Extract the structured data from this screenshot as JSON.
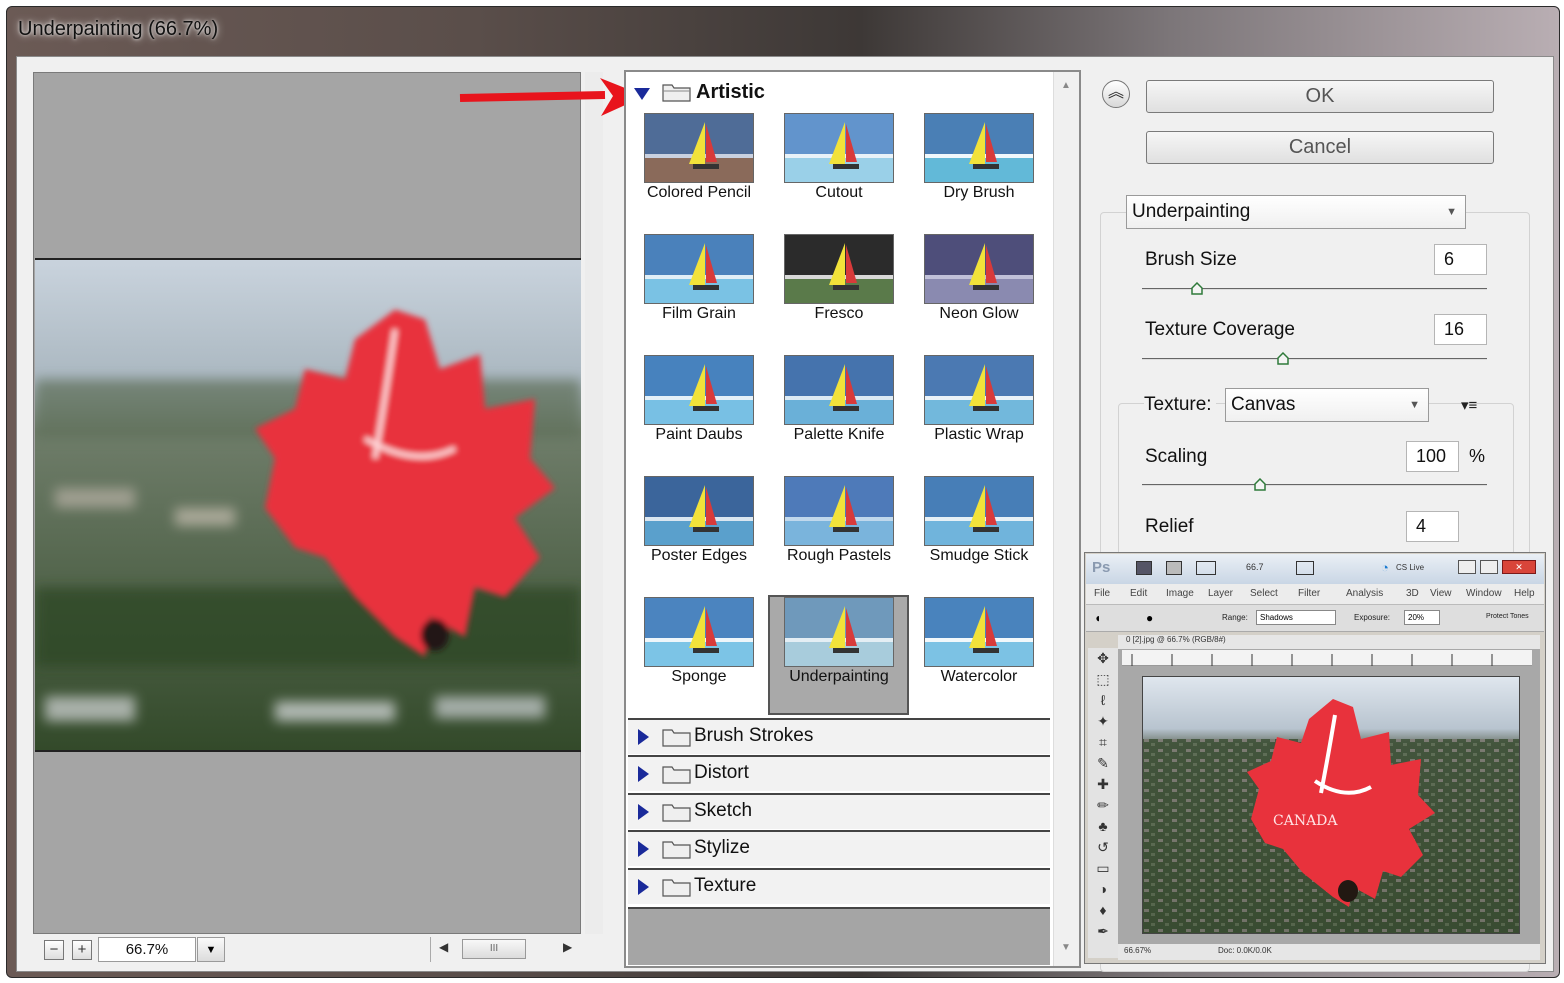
{
  "window": {
    "title": "Underpainting (66.7%)"
  },
  "preview": {
    "zoom": "66.7%",
    "zoom_out_label": "−",
    "zoom_in_label": "+",
    "scroll_grip": "III"
  },
  "gallery": {
    "category_open": "Artistic",
    "filters": [
      {
        "label": "Colored Pencil"
      },
      {
        "label": "Cutout"
      },
      {
        "label": "Dry Brush"
      },
      {
        "label": "Film Grain"
      },
      {
        "label": "Fresco"
      },
      {
        "label": "Neon Glow"
      },
      {
        "label": "Paint Daubs"
      },
      {
        "label": "Palette Knife"
      },
      {
        "label": "Plastic Wrap"
      },
      {
        "label": "Poster Edges"
      },
      {
        "label": "Rough Pastels"
      },
      {
        "label": "Smudge Stick"
      },
      {
        "label": "Sponge"
      },
      {
        "label": "Underpainting"
      },
      {
        "label": "Watercolor"
      }
    ],
    "selected_filter": "Underpainting",
    "categories_closed": [
      "Brush Strokes",
      "Distort",
      "Sketch",
      "Stylize",
      "Texture"
    ]
  },
  "buttons": {
    "ok": "OK",
    "cancel": "Cancel"
  },
  "settings": {
    "filter": "Underpainting",
    "brush_size_label": "Brush Size",
    "brush_size": "6",
    "texture_coverage_label": "Texture Coverage",
    "texture_coverage": "16",
    "texture_label": "Texture:",
    "texture": "Canvas",
    "scaling_label": "Scaling",
    "scaling": "100",
    "scaling_unit": "%",
    "relief_label": "Relief",
    "relief": "4"
  },
  "inset_photoshop": {
    "app_icon": "Ps",
    "zoom": "66.7",
    "cs_live": "CS Live",
    "menu": [
      "File",
      "Edit",
      "Image",
      "Layer",
      "Select",
      "Filter",
      "Analysis",
      "3D",
      "View",
      "Window",
      "Help"
    ],
    "range_label": "Range:",
    "range_value": "Shadows",
    "exposure_label": "Exposure:",
    "exposure_value": "20%",
    "protect_label": "Protect Tones",
    "doc_tab": "0 [2].jpg @ 66.7% (RGB/8#)",
    "status_zoom": "66.67%",
    "status_doc": "Doc: 0.0K/0.0K",
    "image_text": "CANADA"
  },
  "colors": {
    "selection_arrow": "#e8141c",
    "triangle": "#1a2a9a",
    "selected_cell": "#a9a9a9",
    "balloon_red": "#e8323c"
  }
}
